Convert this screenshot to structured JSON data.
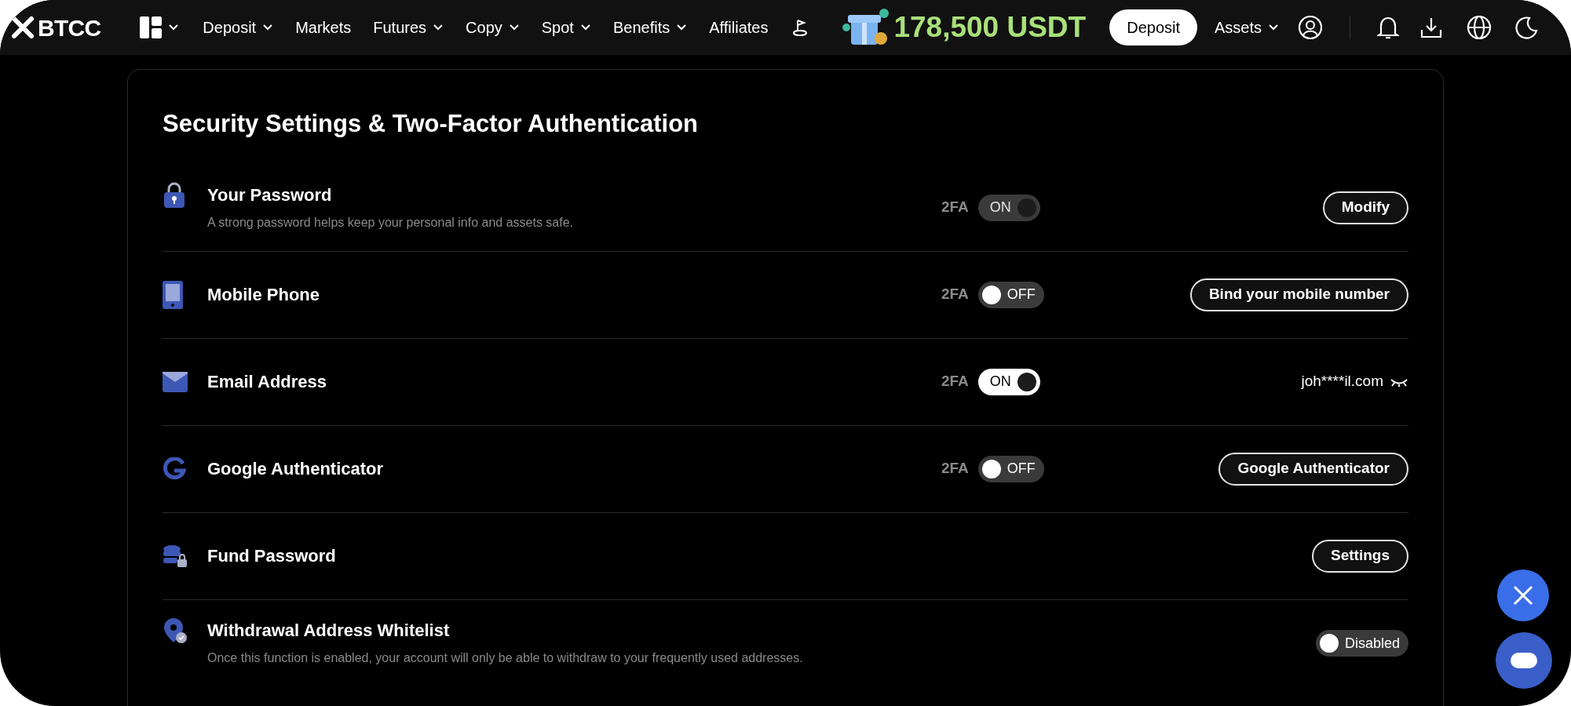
{
  "nav": {
    "logo": "BTCC",
    "items": [
      {
        "label": "Deposit",
        "caret": true
      },
      {
        "label": "Markets",
        "caret": false
      },
      {
        "label": "Futures",
        "caret": true
      },
      {
        "label": "Copy",
        "caret": true
      },
      {
        "label": "Spot",
        "caret": true
      },
      {
        "label": "Benefits",
        "caret": true
      },
      {
        "label": "Affiliates",
        "caret": false
      }
    ],
    "promo": "178,500 USDT",
    "deposit_button": "Deposit",
    "assets": "Assets"
  },
  "title": "Security Settings & Two-Factor Authentication",
  "rows": [
    {
      "label": "Your Password",
      "description": "A strong password helps keep your personal info and assets safe.",
      "twofa": {
        "label": "2FA",
        "on": true,
        "disabled": true,
        "text": "ON"
      },
      "action": {
        "kind": "button",
        "label": "Modify"
      }
    },
    {
      "label": "Mobile Phone",
      "twofa": {
        "label": "2FA",
        "on": false,
        "disabled": false,
        "text": "OFF"
      },
      "action": {
        "kind": "button",
        "label": "Bind your mobile number"
      }
    },
    {
      "label": "Email Address",
      "twofa": {
        "label": "2FA",
        "on": true,
        "disabled": false,
        "text": "ON"
      },
      "action": {
        "kind": "value",
        "label": "joh****il.com"
      }
    },
    {
      "label": "Google Authenticator",
      "twofa": {
        "label": "2FA",
        "on": false,
        "disabled": false,
        "text": "OFF"
      },
      "action": {
        "kind": "button",
        "label": "Google Authenticator"
      }
    },
    {
      "label": "Fund Password",
      "action": {
        "kind": "button",
        "label": "Settings"
      }
    },
    {
      "label": "Withdrawal Address Whitelist",
      "description": "Once this function is enabled, your account will only be able to withdraw to your frequently used addresses.",
      "action": {
        "kind": "switch",
        "label": "Disabled",
        "on": false
      }
    }
  ]
}
